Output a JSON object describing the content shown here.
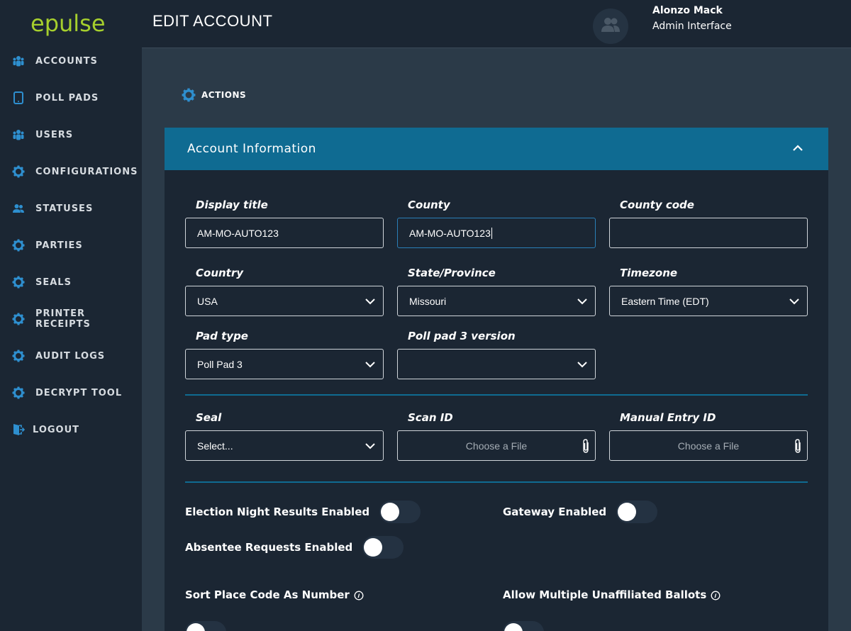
{
  "app": {
    "logo": "epulse"
  },
  "sidebar": {
    "items": [
      {
        "label": "ACCOUNTS",
        "icon": "users-group-icon"
      },
      {
        "label": "POLL PADS",
        "icon": "tablet-icon"
      },
      {
        "label": "USERS",
        "icon": "users-group-icon"
      },
      {
        "label": "CONFIGURATIONS",
        "icon": "gear-icon"
      },
      {
        "label": "STATUSES",
        "icon": "people-icon"
      },
      {
        "label": "PARTIES",
        "icon": "gear-icon"
      },
      {
        "label": "SEALS",
        "icon": "gear-icon"
      },
      {
        "label": "PRINTER RECEIPTS",
        "icon": "gear-icon"
      },
      {
        "label": "AUDIT LOGS",
        "icon": "gear-icon"
      },
      {
        "label": "DECRYPT TOOL",
        "icon": "gear-icon"
      },
      {
        "label": "LOGOUT",
        "icon": "logout-icon"
      }
    ]
  },
  "header": {
    "title": "EDIT ACCOUNT",
    "user_name": "Alonzo Mack",
    "user_role": "Admin Interface"
  },
  "actions": {
    "label": "ACTIONS"
  },
  "panel": {
    "title": "Account Information",
    "fields": {
      "display_title": {
        "label": "Display title",
        "value": "AM-MO-AUTO123"
      },
      "county": {
        "label": "County",
        "value": "AM-MO-AUTO123"
      },
      "county_code": {
        "label": "County code",
        "value": ""
      },
      "country": {
        "label": "Country",
        "value": "USA"
      },
      "state": {
        "label": "State/Province",
        "value": "Missouri"
      },
      "timezone": {
        "label": "Timezone",
        "value": "Eastern Time (EDT)"
      },
      "pad_type": {
        "label": "Pad type",
        "value": "Poll Pad 3"
      },
      "pp3_version": {
        "label": "Poll pad 3 version",
        "value": ""
      },
      "seal": {
        "label": "Seal",
        "value": "Select..."
      },
      "scan_id": {
        "label": "Scan ID",
        "value": "Choose a File"
      },
      "manual_entry_id": {
        "label": "Manual Entry ID",
        "value": "Choose a File"
      }
    },
    "toggles": {
      "election_night": {
        "label": "Election Night Results Enabled",
        "on": false
      },
      "gateway": {
        "label": "Gateway Enabled",
        "on": false
      },
      "absentee": {
        "label": "Absentee Requests Enabled",
        "on": false
      },
      "sort_place": {
        "label": "Sort Place Code As Number",
        "on": false
      },
      "allow_multiple": {
        "label": "Allow Multiple Unaffiliated Ballots",
        "on": false
      }
    }
  },
  "colors": {
    "brand": "#a6cf2d",
    "accent": "#0f6b92",
    "sidebar_bg": "#1b2633",
    "content_bg": "#2b3a48",
    "icon_blue": "#2e8fcf"
  }
}
